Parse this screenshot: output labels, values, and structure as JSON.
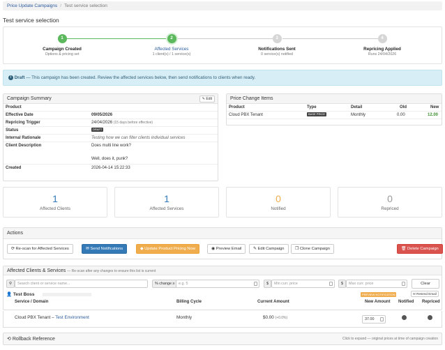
{
  "breadcrumb": {
    "parent": "Price Update Campaigns",
    "separator": "/",
    "current": "Test service selection"
  },
  "page_title": "Test service selection",
  "steps": [
    {
      "num": "1",
      "label": "Campaign Created",
      "sub": "Options & pricing set"
    },
    {
      "num": "2",
      "label": "Affected Services",
      "sub": "1 client(s) / 1 service(s)"
    },
    {
      "num": "3",
      "label": "Notifications Sent",
      "sub": "0 service(s) notified"
    },
    {
      "num": "4",
      "label": "Repricing Applied",
      "sub": "Runs 24/04/2026"
    }
  ],
  "colors": {
    "done": "#5cb85c",
    "inactive": "#cfcfcf",
    "primary": "#337ab7",
    "warning": "#f0ad4e",
    "danger": "#d9534f",
    "success_text": "#3c8d2f"
  },
  "alert": {
    "strong": "Draft",
    "text": " — This campaign has been created. Review the affected services below, then send notifications to clients when ready."
  },
  "summary": {
    "title": "Campaign Summary",
    "edit": "Edit",
    "section": "Product",
    "effective_label": "Effective Date",
    "effective": "09/05/2026",
    "trigger_label": "Repricing Trigger",
    "trigger": "24/04/2026",
    "trigger_note": "(15 days before effective)",
    "status_label": "Status",
    "status": "DRAFT",
    "rationale_label": "Internal Rationale",
    "rationale": "Testing how we can filter clients individual services",
    "desc_label": "Client Description",
    "desc1": "Does multi line work?",
    "desc2": "Well, does it, punk?",
    "created_label": "Created",
    "created": "2026-04-14 15:22:33"
  },
  "price_items": {
    "title": "Price Change Items",
    "headers": [
      "Product",
      "Type",
      "Detail",
      "Old",
      "New"
    ],
    "row": {
      "product": "Cloud PBX Tenant",
      "type": "BASE PRICE",
      "detail": "Monthly",
      "old": "0.00",
      "new": "12.00"
    }
  },
  "stats": [
    {
      "value": "1",
      "label": "Affected Clients",
      "color": "#337ab7"
    },
    {
      "value": "1",
      "label": "Affected Services",
      "color": "#337ab7"
    },
    {
      "value": "0",
      "label": "Notified",
      "color": "#f0ad4e"
    },
    {
      "value": "0",
      "label": "Repriced",
      "color": "#999999"
    }
  ],
  "actions": {
    "title": "Actions",
    "rescan": "Re-scan for Affected Services",
    "send": "Send Notifications",
    "update": "Update Product Pricing Now",
    "preview": "Preview Email",
    "edit": "Edit Campaign",
    "clone": "Clone Campaign",
    "delete": "Delete Campaign"
  },
  "clients": {
    "title": "Affected Clients & Services",
    "subtitle": "— Re-scan after any changes to ensure this list is current",
    "search_placeholder": "Search client or service name...",
    "pct_label": "% change ≥",
    "pct_placeholder": "e.g. 5",
    "min_label": "$",
    "min_placeholder": "Min curr. price",
    "max_label": "$",
    "max_placeholder": "Max curr. price",
    "clear": "Clear",
    "client_name": "Test Boss",
    "preview_badge": "PREVIEW NOTIFICATION",
    "resend": "Resend Email",
    "headers": [
      "Service / Domain",
      "Billing Cycle",
      "Current Amount",
      "New Amount",
      "Notified",
      "Repriced"
    ],
    "row": {
      "service": "Cloud PBX Tenant",
      "dash": " – ",
      "env": "Test Environment",
      "cycle": "Monthly",
      "amount": "$0.00",
      "pct": "(+0.0%)",
      "new": "37.00"
    }
  },
  "rollback": {
    "title": "Rollback Reference",
    "note": "Click to expand — original prices at time of campaign creation"
  }
}
